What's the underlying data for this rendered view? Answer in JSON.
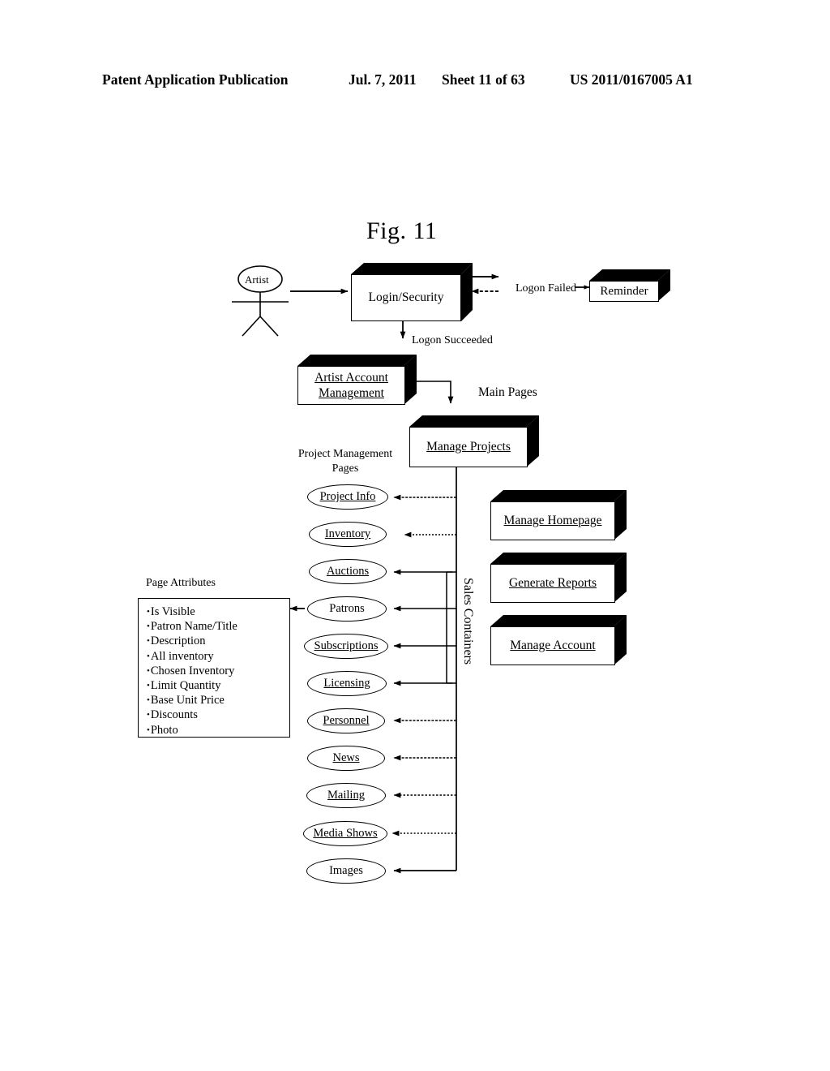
{
  "header": {
    "publication": "Patent Application Publication",
    "date": "Jul. 7, 2011",
    "sheet": "Sheet 11 of 63",
    "number": "US 2011/0167005 A1"
  },
  "figure": {
    "title": "Fig. 11"
  },
  "actor": {
    "label": "Artist"
  },
  "boxes": {
    "login": "Login/Security",
    "reminder": "Reminder",
    "artist_account": "Artist Account\nManagement",
    "artist_account_line1": "Artist Account",
    "artist_account_line2": "Management",
    "manage_projects": "Manage Projects",
    "manage_homepage": "Manage Homepage",
    "generate_reports": "Generate Reports",
    "manage_account": "Manage Account"
  },
  "edge_labels": {
    "logon_failed": "Logon Failed",
    "logon_succeeded": "Logon Succeeded",
    "main_pages": "Main Pages",
    "project_management_pages_line1": "Project Management",
    "project_management_pages_line2": "Pages",
    "sales_containers": "Sales Containers",
    "page_attributes": "Page Attributes"
  },
  "pages": [
    {
      "label": "Project Info"
    },
    {
      "label": "Inventory"
    },
    {
      "label": "Auctions"
    },
    {
      "label": "Patrons"
    },
    {
      "label": "Subscriptions"
    },
    {
      "label": "Licensing"
    },
    {
      "label": "Personnel"
    },
    {
      "label": "News"
    },
    {
      "label": "Mailing"
    },
    {
      "label": "Media Shows"
    },
    {
      "label": "Images"
    }
  ],
  "page_attributes": [
    "Is Visible",
    "Patron Name/Title",
    "Description",
    "All inventory",
    "Chosen Inventory",
    "Limit Quantity",
    "Base Unit Price",
    "Discounts",
    "Photo"
  ],
  "colors": {
    "ink": "#000000",
    "paper": "#ffffff"
  }
}
